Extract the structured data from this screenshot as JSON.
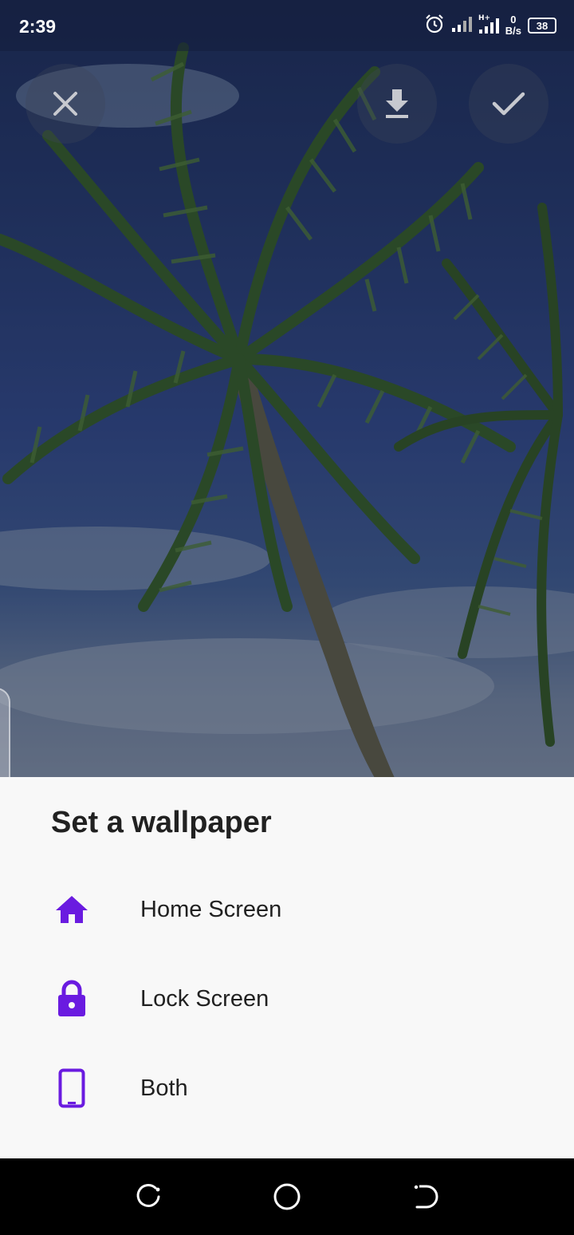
{
  "status_bar": {
    "time": "2:39",
    "icons": [
      "alarm-icon",
      "signal-icon",
      "hplus-signal-icon"
    ],
    "net_speed_value": "0",
    "net_speed_unit": "B/s",
    "battery_level": "38"
  },
  "top_actions": {
    "close_icon": "close-icon",
    "download_icon": "download-icon",
    "apply_icon": "check-icon"
  },
  "sheet": {
    "title": "Set a wallpaper",
    "accent_color": "#6a1be0",
    "options": [
      {
        "label": "Home Screen",
        "icon": "home-icon"
      },
      {
        "label": "Lock Screen",
        "icon": "lock-icon"
      },
      {
        "label": "Both",
        "icon": "phone-icon"
      }
    ]
  },
  "nav_bar": {
    "recent_icon": "recent-apps-icon",
    "home_icon": "home-circle-icon",
    "back_icon": "back-icon"
  }
}
